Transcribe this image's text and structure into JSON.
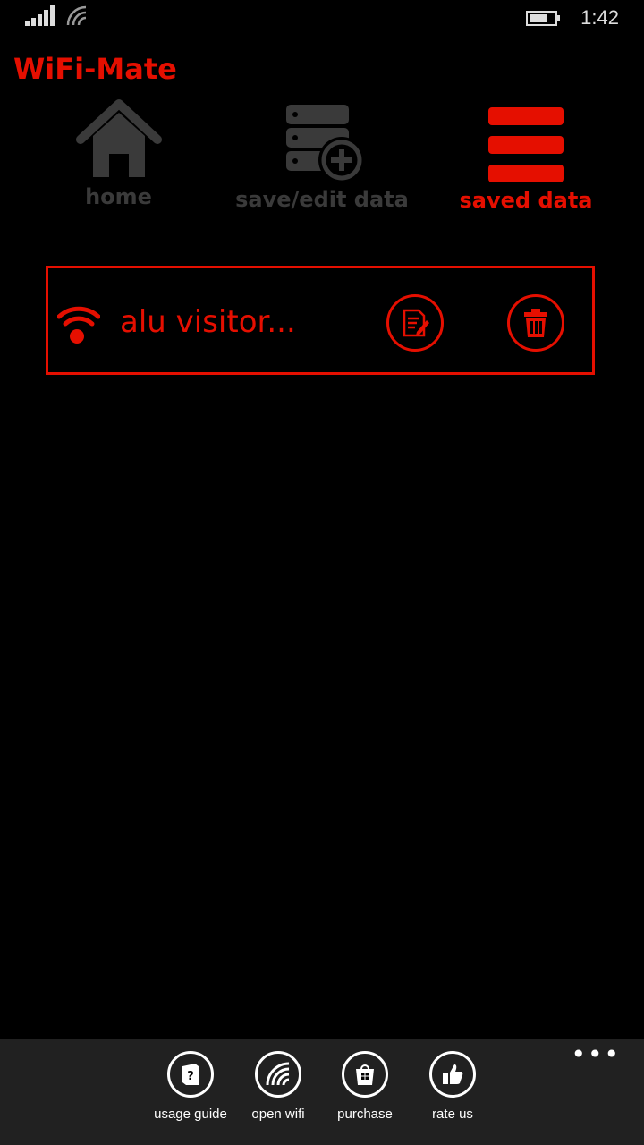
{
  "status_bar": {
    "time": "1:42"
  },
  "app": {
    "title": "WiFi-Mate"
  },
  "nav": {
    "items": [
      {
        "label": "home",
        "icon": "home-icon",
        "active": false
      },
      {
        "label": "save/edit data",
        "icon": "database-add-icon",
        "active": false
      },
      {
        "label": "saved data",
        "icon": "list-icon",
        "active": true
      }
    ]
  },
  "saved_list": {
    "items": [
      {
        "name": "alu visitor..."
      }
    ]
  },
  "app_bar": {
    "buttons": [
      {
        "label": "usage guide",
        "icon": "book-help-icon"
      },
      {
        "label": "open wifi",
        "icon": "wifi-icon"
      },
      {
        "label": "purchase",
        "icon": "store-icon"
      },
      {
        "label": "rate us",
        "icon": "thumbs-up-icon"
      }
    ],
    "more": "•••"
  },
  "colors": {
    "accent": "#e50f00",
    "inactive": "#3a3a3a",
    "appbar_bg": "#212121"
  }
}
